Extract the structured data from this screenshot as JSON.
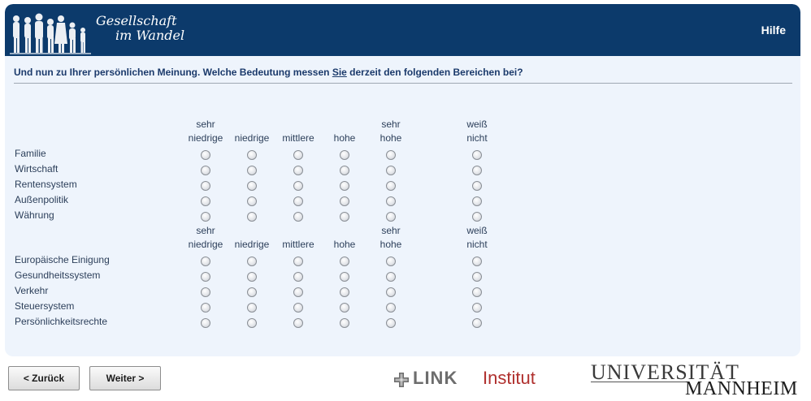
{
  "header": {
    "logo_line1": "Gesellschaft",
    "logo_line2": "im Wandel",
    "help_label": "Hilfe"
  },
  "question": {
    "prefix": "Und nun zu Ihrer persönlichen Meinung. Welche Bedeutung messen ",
    "emphasis": "Sie",
    "suffix": " derzeit den folgenden Bereichen bei?"
  },
  "scale": [
    {
      "line1": "sehr",
      "line2": "niedrige"
    },
    {
      "line1": "",
      "line2": "niedrige"
    },
    {
      "line1": "",
      "line2": "mittlere"
    },
    {
      "line1": "",
      "line2": "hohe"
    },
    {
      "line1": "sehr",
      "line2": "hohe"
    },
    {
      "line1": "weiß",
      "line2": "nicht"
    }
  ],
  "groups": [
    {
      "items": [
        "Familie",
        "Wirtschaft",
        "Rentensystem",
        "Außenpolitik",
        "Währung"
      ]
    },
    {
      "items": [
        "Europäische Einigung",
        "Gesundheitssystem",
        "Verkehr",
        "Steuersystem",
        "Persönlichkeitsrechte"
      ]
    }
  ],
  "buttons": {
    "back": "< Zurück",
    "next": "Weiter >"
  },
  "footer": {
    "link_bold": "LINK",
    "link_institut": "Institut",
    "uni_line1": "UNIVERSITÄT",
    "uni_line2": "MANNHEIM"
  },
  "colors": {
    "header_bg": "#0c3a6b",
    "panel_bg": "#eef4fc",
    "link_red": "#b0302e"
  }
}
